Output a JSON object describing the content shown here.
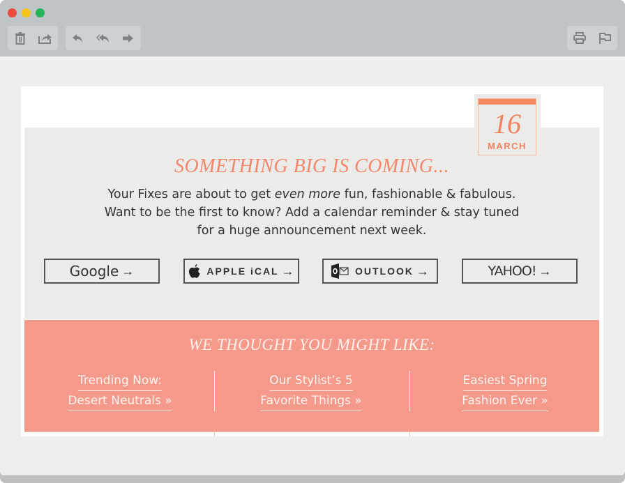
{
  "window": {
    "traffic_lights": [
      "close",
      "minimize",
      "zoom"
    ]
  },
  "toolbar": {
    "left_group_1": [
      {
        "name": "delete",
        "icon": "trash-icon"
      },
      {
        "name": "move",
        "icon": "move-to-icon"
      }
    ],
    "left_group_2": [
      {
        "name": "reply",
        "icon": "reply-icon"
      },
      {
        "name": "reply-all",
        "icon": "reply-all-icon"
      },
      {
        "name": "forward",
        "icon": "forward-icon"
      }
    ],
    "right_group": [
      {
        "name": "print",
        "icon": "printer-icon"
      },
      {
        "name": "flag",
        "icon": "flag-icon"
      }
    ]
  },
  "email": {
    "calendar_badge": {
      "day": "16",
      "month": "MARCH"
    },
    "headline": "SOMETHING BIG IS COMING...",
    "body": {
      "line1_pre": "Your Fixes are about to get ",
      "line1_em": "even more",
      "line1_post": " fun, fashionable & fabulous.",
      "line2": "Want to be the first to know? Add a calendar reminder & stay tuned",
      "line3": "for a huge announcement next week."
    },
    "calendar_buttons": [
      {
        "label": "Google",
        "arrow": "→",
        "icon": "google-wordmark"
      },
      {
        "label": "APPLE iCAL",
        "arrow": "→",
        "icon": "apple-icon"
      },
      {
        "label": "OUTLOOK",
        "arrow": "→",
        "icon": "outlook-icon"
      },
      {
        "label": "YAHOO!",
        "arrow": "→",
        "icon": "yahoo-wordmark"
      }
    ],
    "promo": {
      "title": "WE THOUGHT YOU MIGHT LIKE:",
      "links": [
        {
          "line1": "Trending Now:",
          "line2": "Desert Neutrals »"
        },
        {
          "line1": "Our Stylist’s 5",
          "line2": "Favorite Things »"
        },
        {
          "line1": "Easiest Spring",
          "line2": "Fashion Ever »"
        }
      ]
    },
    "colors": {
      "accent": "#f2825d",
      "promo_bg": "#f59a8b",
      "hero_bg": "#ebebe9"
    }
  }
}
